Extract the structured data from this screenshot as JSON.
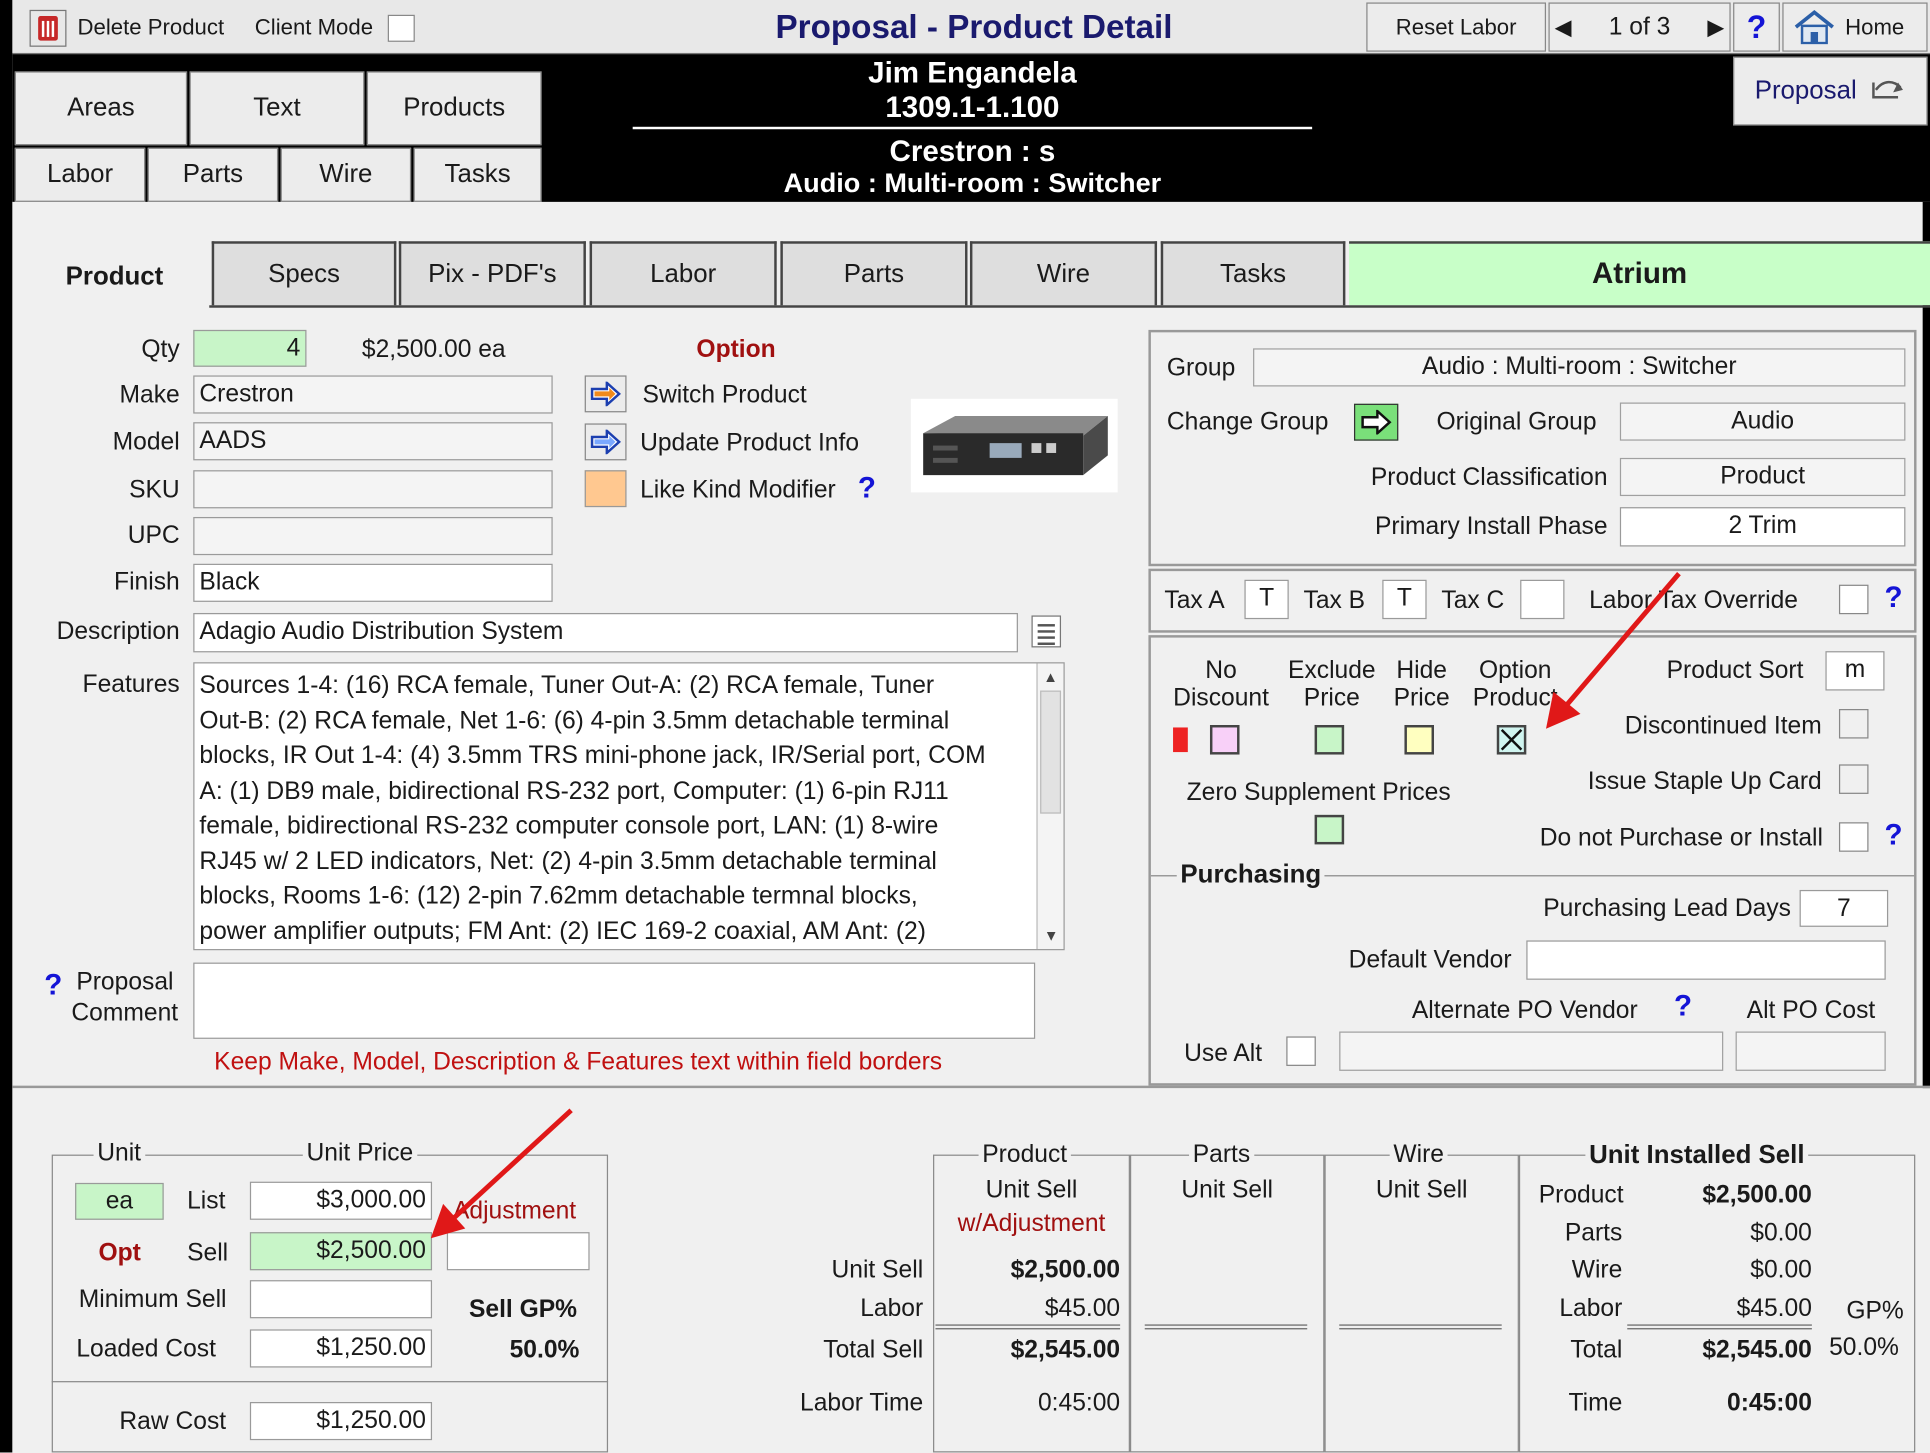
{
  "toolbar": {
    "delete_label": "Delete Product",
    "client_mode_label": "Client Mode",
    "title": "Proposal - Product Detail",
    "reset_labor_label": "Reset Labor",
    "record_counter": "1 of 3",
    "help_glyph": "?",
    "home_label": "Home"
  },
  "header": {
    "client_name": "Jim Engandela",
    "proposal_number": "1309.1-1.100",
    "manufacturer_line": "Crestron : s",
    "group_line": "Audio : Multi-room : Switcher",
    "proposal_button": "Proposal"
  },
  "nav": {
    "row1": [
      "Areas",
      "Text",
      "Products"
    ],
    "row2": [
      "Labor",
      "Parts",
      "Wire",
      "Tasks"
    ]
  },
  "tabs": [
    "Product",
    "Specs",
    "Pix - PDF's",
    "Labor",
    "Parts",
    "Wire",
    "Tasks"
  ],
  "area_name": "Atrium",
  "product": {
    "qty_label": "Qty",
    "qty": "4",
    "price_each": "$2,500.00 ea",
    "option_label": "Option",
    "make_label": "Make",
    "make": "Crestron",
    "model_label": "Model",
    "model": "AADS",
    "sku_label": "SKU",
    "sku": "",
    "upc_label": "UPC",
    "upc": "",
    "finish_label": "Finish",
    "finish": "Black",
    "description_label": "Description",
    "description": "Adagio Audio Distribution System",
    "features_label": "Features",
    "features_lines": [
      "Sources 1-4: (16) RCA female, Tuner Out-A: (2) RCA female, Tuner",
      "Out-B: (2) RCA female, Net 1-6: (6) 4-pin 3.5mm detachable terminal",
      "blocks, IR Out 1-4: (4) 3.5mm TRS mini-phone jack, IR/Serial port, COM",
      "A: (1) DB9 male, bidirectional RS-232 port, Computer: (1) 6-pin RJ11",
      "female, bidirectional RS-232 computer console port, LAN: (1) 8-wire",
      "RJ45 w/ 2 LED indicators, Net: (2) 4-pin 3.5mm detachable terminal",
      "blocks, Rooms 1-6: (12) 2-pin 7.62mm detachable termnal blocks,",
      "power amplifier outputs; FM Ant: (2) IEC 169-2 coaxial, AM Ant: (2)"
    ],
    "proposal_comment_label_1": "Proposal",
    "proposal_comment_label_2": "Comment",
    "proposal_comment": "",
    "warning": "Keep Make, Model, Description & Features text within field borders",
    "switch_product": "Switch Product",
    "update_product_info": "Update Product Info",
    "like_kind_modifier": "Like Kind Modifier"
  },
  "group_panel": {
    "group_label": "Group",
    "group": "Audio : Multi-room : Switcher",
    "change_group_label": "Change Group",
    "original_group_label": "Original Group",
    "original_group": "Audio",
    "classification_label": "Product Classification",
    "classification": "Product",
    "install_phase_label": "Primary Install Phase",
    "install_phase": "2 Trim"
  },
  "tax": {
    "tax_a_label": "Tax A",
    "tax_a": "T",
    "tax_b_label": "Tax B",
    "tax_b": "T",
    "tax_c_label": "Tax C",
    "tax_c": "",
    "labor_tax_override_label": "Labor Tax Override"
  },
  "flags": {
    "no_discount_1": "No",
    "no_discount_2": "Discount",
    "exclude_price_1": "Exclude",
    "exclude_price_2": "Price",
    "hide_price_1": "Hide",
    "hide_price_2": "Price",
    "option_product_1": "Option",
    "option_product_2": "Product",
    "zero_supplement": "Zero Supplement Prices",
    "product_sort_label": "Product Sort",
    "product_sort": "m",
    "discontinued_label": "Discontinued Item",
    "staple_up_label": "Issue Staple Up Card",
    "do_not_purchase_label": "Do not Purchase or Install"
  },
  "purchasing": {
    "title": "Purchasing",
    "lead_days_label": "Purchasing Lead Days",
    "lead_days": "7",
    "default_vendor_label": "Default Vendor",
    "default_vendor": "",
    "alt_po_vendor_label": "Alternate PO Vendor",
    "alt_po_cost_label": "Alt PO Cost",
    "use_alt_label": "Use Alt"
  },
  "pricing": {
    "unit_legend": "Unit",
    "unit_price_legend": "Unit Price",
    "unit": "ea",
    "list_label": "List",
    "list": "$3,000.00",
    "adjustment_label": "Adjustment",
    "opt_label": "Opt",
    "sell_label": "Sell",
    "sell": "$2,500.00",
    "adjustment": "",
    "minimum_sell_label": "Minimum Sell",
    "minimum_sell": "",
    "sell_gp_label": "Sell GP%",
    "sell_gp": "50.0%",
    "loaded_cost_label": "Loaded Cost",
    "loaded_cost": "$1,250.00",
    "raw_cost_label": "Raw Cost",
    "raw_cost": "$1,250.00"
  },
  "summary": {
    "product_legend": "Product",
    "product_sub_1": "Unit Sell",
    "product_sub_2": "w/Adjustment",
    "parts_legend": "Parts",
    "parts_sub": "Unit Sell",
    "wire_legend": "Wire",
    "wire_sub": "Unit Sell",
    "unit_sell_label": "Unit Sell",
    "unit_sell": "$2,500.00",
    "labor_label": "Labor",
    "labor": "$45.00",
    "total_sell_label": "Total Sell",
    "total_sell": "$2,545.00",
    "labor_time_label": "Labor Time",
    "labor_time": "0:45:00"
  },
  "installed": {
    "legend": "Unit Installed Sell",
    "product_label": "Product",
    "product": "$2,500.00",
    "parts_label": "Parts",
    "parts": "$0.00",
    "wire_label": "Wire",
    "wire": "$0.00",
    "labor_label": "Labor",
    "labor": "$45.00",
    "gp_label": "GP%",
    "total_label": "Total",
    "total": "$2,545.00",
    "gp": "50.0%",
    "time_label": "Time",
    "time": "0:45:00"
  },
  "colors": {
    "header_bg": "#000000",
    "field_green": "#c8f5c8",
    "atrium_bg": "#c8ffc8",
    "title_blue": "#1a1a6e",
    "warning_red": "#c01010",
    "arrow_red": "#e01818"
  }
}
